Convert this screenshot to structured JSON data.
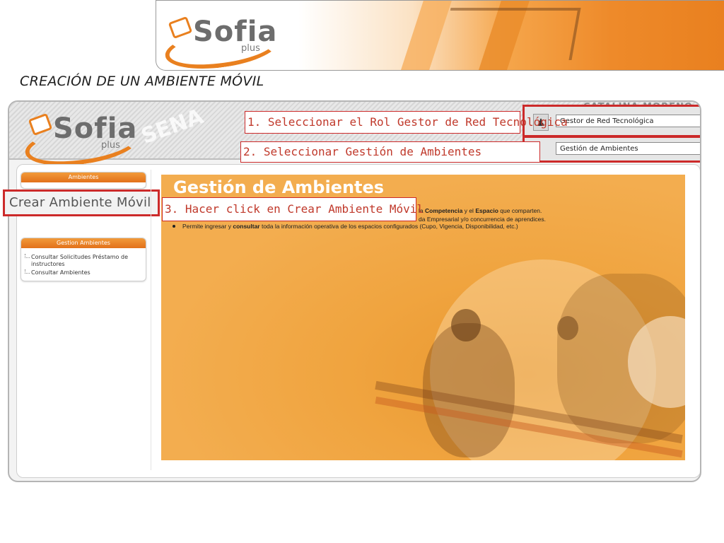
{
  "slide": {
    "title": "CREACIÓN DE UN AMBIENTE MÓVIL"
  },
  "logo": {
    "word": "Sofia",
    "sub": "plus"
  },
  "header": {
    "user_name": "CATALINA MORENO",
    "role_select_value": "Gestor de Red Tecnológica",
    "gestion_select_value": "Gestión de Ambientes",
    "icons": [
      "user-icon",
      "chevron-down-icon"
    ]
  },
  "callouts": {
    "step1": "1. Seleccionar el Rol Gestor de Red Tecnológica",
    "step2": "2. Seleccionar Gestión de Ambientes",
    "step3": "3. Hacer click en Crear Ambiente Móvil"
  },
  "sidebar": {
    "panel1_title": "Ambientes",
    "crear_link": "Crear Ambiente Móvil",
    "panel2_title": "Gestion Ambientes",
    "items": [
      "Consultar Solicitudes Préstamo de instructores",
      "Consultar Ambientes"
    ]
  },
  "content": {
    "title": "Gestión de Ambientes",
    "line1_a": "la ",
    "line1_b": "Competencia",
    "line1_c": " y el ",
    "line1_d": "Espacio",
    "line1_e": " que comparten.",
    "line2": "da Empresarial y/o concurrencia de aprendices.",
    "line3_a": "Permite ingresar y ",
    "line3_b": "consultar",
    "line3_c": " toda la información operativa de los espacios configurados (Cupo, Vigencia, Disponibilidad, etc.)"
  },
  "colors": {
    "accent_orange": "#e9801f",
    "callout_red": "#cc2a2a"
  }
}
